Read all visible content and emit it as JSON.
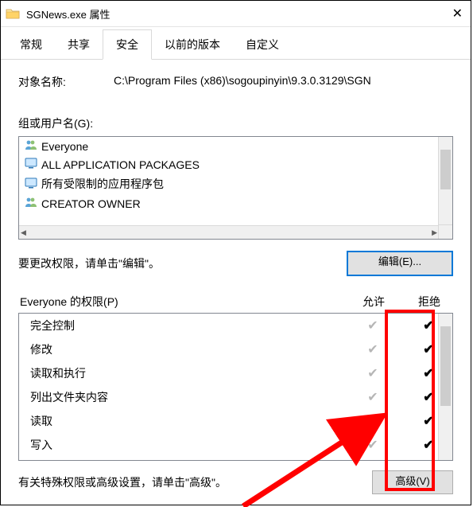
{
  "window": {
    "title": "SGNews.exe 属性"
  },
  "tabs": {
    "general": "常规",
    "sharing": "共享",
    "security": "安全",
    "previous": "以前的版本",
    "custom": "自定义"
  },
  "object": {
    "label": "对象名称:",
    "path": "C:\\Program Files (x86)\\sogoupinyin\\9.3.0.3129\\SGN"
  },
  "groups": {
    "label": "组或用户名(G):",
    "items": [
      {
        "icon": "group",
        "name": "Everyone"
      },
      {
        "icon": "pkg",
        "name": "ALL APPLICATION PACKAGES"
      },
      {
        "icon": "pkg",
        "name": "所有受限制的应用程序包"
      },
      {
        "icon": "group",
        "name": "CREATOR OWNER"
      }
    ]
  },
  "editHint": "要更改权限，请单击\"编辑\"。",
  "editBtn": "编辑(E)...",
  "perm": {
    "header_name": "Everyone 的权限(P)",
    "header_allow": "允许",
    "header_deny": "拒绝",
    "rows": [
      {
        "name": "完全控制"
      },
      {
        "name": "修改"
      },
      {
        "name": "读取和执行"
      },
      {
        "name": "列出文件夹内容"
      },
      {
        "name": "读取"
      },
      {
        "name": "写入"
      }
    ]
  },
  "footer": {
    "hint": "有关特殊权限或高级设置，请单击\"高级\"。",
    "advBtn": "高级(V)"
  }
}
